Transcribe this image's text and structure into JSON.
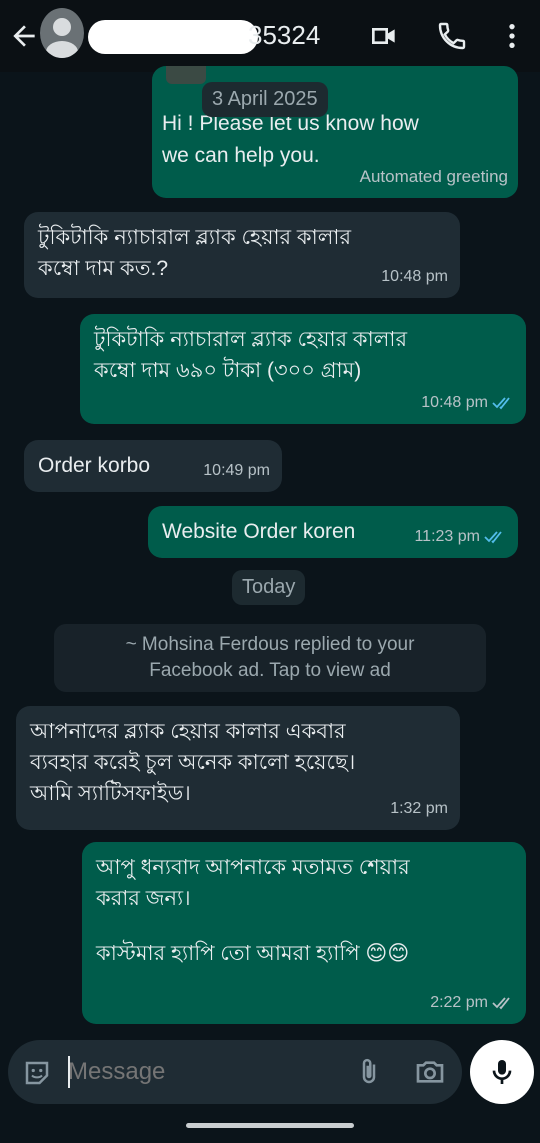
{
  "header": {
    "contact_number": "35324",
    "icons": [
      "back-arrow-icon",
      "video-call-icon",
      "phone-icon",
      "more-vert-icon"
    ]
  },
  "messages": [
    {
      "type": "outgoing",
      "text_line1": "Hi ! Please let us know how",
      "text_line2": "we can help you.",
      "footer": "Automated greeting"
    },
    {
      "type": "incoming",
      "text_line1": "টুকিটাকি ন্যাচারাল ব্ল্যাক হেয়ার কালার",
      "text_line2": "কম্বো দাম কত.?",
      "time": "10:48 pm"
    },
    {
      "type": "outgoing",
      "text_line1": "টুকিটাকি ন্যাচারাল ব্ল্যাক হেয়ার কালার",
      "text_line2": "কম্বো দাম ৬৯০ টাকা (৩০০ গ্রাম)",
      "time": "10:48 pm"
    },
    {
      "type": "incoming",
      "text": "Order korbo",
      "time": "10:49 pm"
    },
    {
      "type": "outgoing",
      "text": "Website Order koren",
      "time": "11:23 pm"
    },
    {
      "type": "incoming",
      "text_line1": "আপনাদের ব্ল্যাক হেয়ার কালার একবার",
      "text_line2": "ব্যবহার করেই চুল অনেক কালো হয়েছে।",
      "text_line3": "আমি স্যাটিসফাইড।",
      "time": "1:32 pm"
    },
    {
      "type": "outgoing",
      "text_line1": "আপু ধন্যবাদ আপনাকে মতামত শেয়ার",
      "text_line2": "করার জন্য।",
      "text_line3": "কাস্টমার হ্যাপি তো আমরা হ্যাপি 😊😊",
      "time": "2:22 pm"
    }
  ],
  "date_chips": {
    "first": "3 April 2025",
    "second": "Today"
  },
  "system_notice": {
    "line1": "~ Mohsina Ferdous replied to your",
    "line2": "Facebook ad. Tap to view ad"
  },
  "composer": {
    "placeholder": "Message"
  },
  "colors": {
    "incoming_bubble": "#1f2c34",
    "outgoing_bubble": "#005c4b",
    "background": "#0b141a",
    "read_tick": "#53bdeb"
  }
}
